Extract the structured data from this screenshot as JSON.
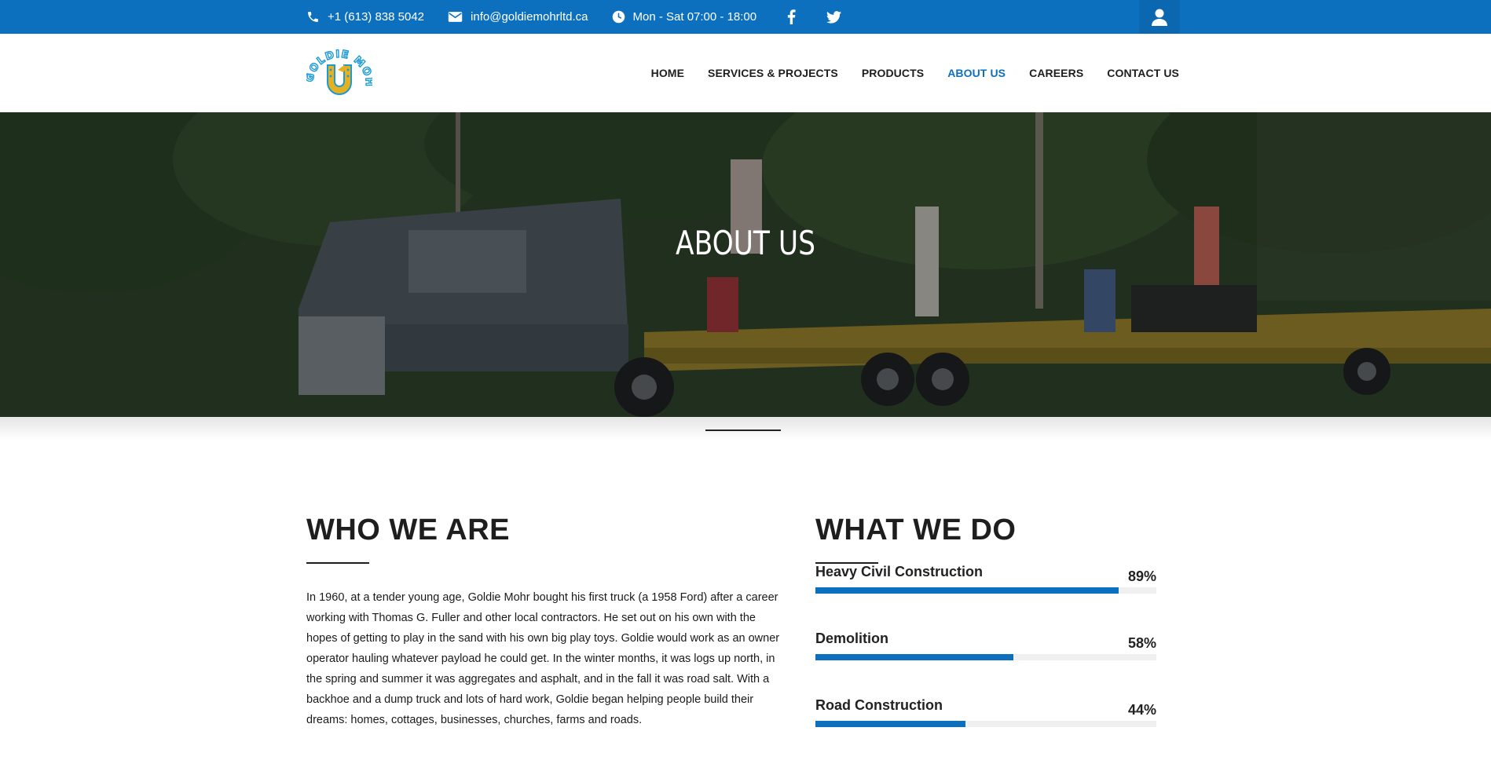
{
  "topbar": {
    "phone": "+1 (613) 838 5042",
    "email": "info@goldiemohrltd.ca",
    "hours": "Mon - Sat 07:00 - 18:00",
    "social_icons": [
      "facebook-icon",
      "twitter-icon"
    ],
    "user_icon": "user-icon"
  },
  "brand": {
    "logo_text": "GOLDIE MOHR LTD",
    "logo_colors": {
      "ring": "#1b9ad6",
      "horseshoe": "#e6b11e"
    }
  },
  "nav": {
    "items": [
      {
        "label": "HOME"
      },
      {
        "label": "SERVICES & PROJECTS"
      },
      {
        "label": "PRODUCTS"
      },
      {
        "label": "ABOUT US",
        "active": true
      },
      {
        "label": "CAREERS"
      },
      {
        "label": "CONTACT US"
      }
    ]
  },
  "hero": {
    "title": "ABOUT US"
  },
  "who": {
    "title": "WHO WE ARE",
    "text": "In 1960, at a tender young age, Goldie Mohr bought his first truck (a 1958 Ford) after a career working with Thomas G. Fuller and other local contractors. He set out on his own with the hopes of getting to play in the sand with his own big play toys. Goldie would work as an owner operator hauling whatever payload he could get. In the winter months, it was logs up north, in the spring and summer it was aggregates and asphalt, and in the fall it was road salt. With a backhoe and a dump truck and lots of hard work, Goldie began helping people build their dreams: homes, cottages, businesses, churches, farms and roads."
  },
  "what": {
    "title": "WHAT WE DO",
    "skills": [
      {
        "label": "Heavy Civil Construction",
        "value": "89%",
        "percent": 89
      },
      {
        "label": "Demolition",
        "value": "58%",
        "percent": 58
      },
      {
        "label": "Road Construction",
        "value": "44%",
        "percent": 44
      }
    ]
  },
  "colors": {
    "brand_blue": "#0c70bf",
    "text": "#1e1e1e",
    "track": "#f0f0f0"
  }
}
